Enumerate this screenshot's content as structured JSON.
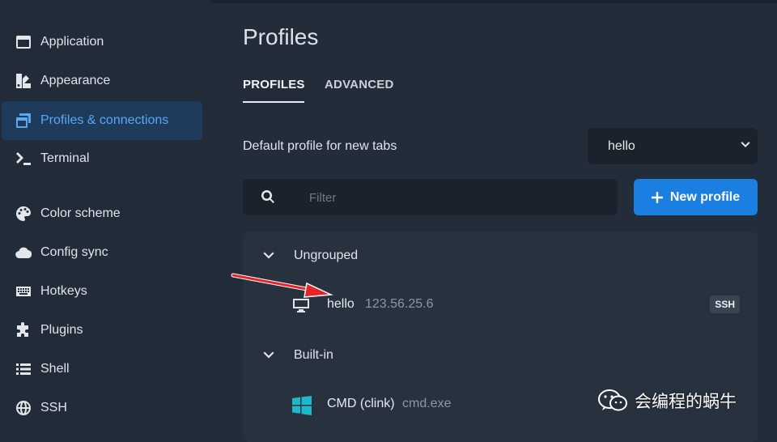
{
  "sidebar": {
    "items": [
      {
        "label": "Application",
        "icon": "application-icon"
      },
      {
        "label": "Appearance",
        "icon": "appearance-icon"
      },
      {
        "label": "Profiles & connections",
        "icon": "window-stack-icon",
        "active": true
      },
      {
        "label": "Terminal",
        "icon": "terminal-prompt-icon"
      },
      {
        "label": "Color scheme",
        "icon": "palette-icon"
      },
      {
        "label": "Config sync",
        "icon": "cloud-icon"
      },
      {
        "label": "Hotkeys",
        "icon": "keyboard-icon"
      },
      {
        "label": "Plugins",
        "icon": "puzzle-icon"
      },
      {
        "label": "Shell",
        "icon": "list-icon"
      },
      {
        "label": "SSH",
        "icon": "globe-icon"
      }
    ]
  },
  "main": {
    "title": "Profiles",
    "tabs": [
      {
        "label": "PROFILES",
        "active": true
      },
      {
        "label": "ADVANCED",
        "active": false
      }
    ],
    "default_profile": {
      "label": "Default profile for new tabs",
      "value": "hello"
    },
    "filter": {
      "placeholder": "Filter",
      "value": ""
    },
    "new_profile_button": "New profile",
    "groups": [
      {
        "label": "Ungrouped",
        "expanded": true,
        "profiles": [
          {
            "name": "hello",
            "host": "123.56.25.6",
            "badge": "SSH",
            "icon": "monitor-icon"
          }
        ]
      },
      {
        "label": "Built-in",
        "expanded": true,
        "profiles": [
          {
            "name": "CMD (clink)",
            "host": "cmd.exe",
            "icon": "windows-logo-icon"
          }
        ]
      }
    ]
  },
  "watermark": {
    "text": "会编程的蜗牛"
  },
  "colors": {
    "background": "#232d3a",
    "sidebar_active_bg": "#1e3b5c",
    "accent": "#1a7fe0",
    "annotation_arrow": "#e8232a",
    "windows_logo": "#1fb8c9"
  }
}
